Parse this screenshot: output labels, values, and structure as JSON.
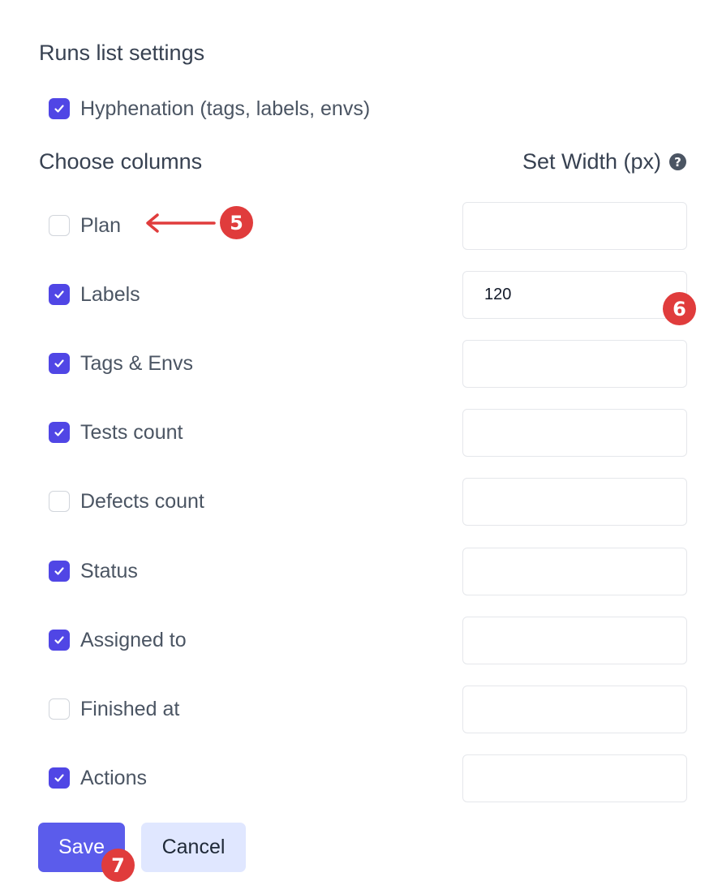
{
  "section_title": "Runs list settings",
  "hyphenation": {
    "label": "Hyphenation (tags, labels, envs)",
    "checked": true
  },
  "choose_columns_label": "Choose columns",
  "set_width_label": "Set Width (px)",
  "columns": [
    {
      "label": "Plan",
      "checked": false,
      "width": ""
    },
    {
      "label": "Labels",
      "checked": true,
      "width": "120"
    },
    {
      "label": "Tags & Envs",
      "checked": true,
      "width": ""
    },
    {
      "label": "Tests count",
      "checked": true,
      "width": ""
    },
    {
      "label": "Defects count",
      "checked": false,
      "width": ""
    },
    {
      "label": "Status",
      "checked": true,
      "width": ""
    },
    {
      "label": "Assigned to",
      "checked": true,
      "width": ""
    },
    {
      "label": "Finished at",
      "checked": false,
      "width": ""
    },
    {
      "label": "Actions",
      "checked": true,
      "width": ""
    }
  ],
  "buttons": {
    "save": "Save",
    "cancel": "Cancel"
  },
  "annotations": {
    "plan_marker": "5",
    "width_marker": "6",
    "save_marker": "7"
  },
  "help_glyph": "?",
  "icons": {
    "checkbox": "check-icon",
    "help": "help-icon",
    "arrow": "arrow-left-icon"
  },
  "colors": {
    "accent": "#5046e5",
    "save_button": "#5b5ceb",
    "cancel_button": "#e0e7ff",
    "marker": "#e03c3c"
  }
}
